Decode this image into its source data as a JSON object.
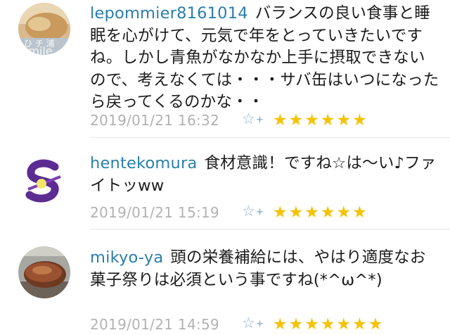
{
  "comments": [
    {
      "user": "lepommier8161014",
      "text": "バランスの良い食事と睡眠を心がけて、元気で年をとっていきたいですね。しかし青魚がなかなか上手に摂取できないので、考えなくては・・・サバ缶はいつになったら戻ってくるのかな・・",
      "date": "2019/01/21 16:32",
      "stars": "★★★★★★",
      "avatar_icon": "food-photo-avatar"
    },
    {
      "user": "hentekomura",
      "text": "食材意識！ですね☆は〜い♪ファイトッww",
      "date": "2019/01/21 15:19",
      "stars": "★★★★★★",
      "avatar_icon": "purple-s-logo-avatar"
    },
    {
      "user": "mikyo-ya",
      "text": "頭の栄養補給には、やはり適度なお菓子祭りは必須という事ですね(*^ω^*)",
      "date": "2019/01/21 14:59",
      "stars": "★★★★★★★",
      "avatar_icon": "meat-dish-avatar"
    }
  ],
  "add_star_icon": "add-star-icon",
  "colors": {
    "username": "#2a7fab",
    "text": "#1c1c1c",
    "date": "#b2b2b2",
    "star": "#f5c200",
    "add_star": "#8bb2d6"
  }
}
